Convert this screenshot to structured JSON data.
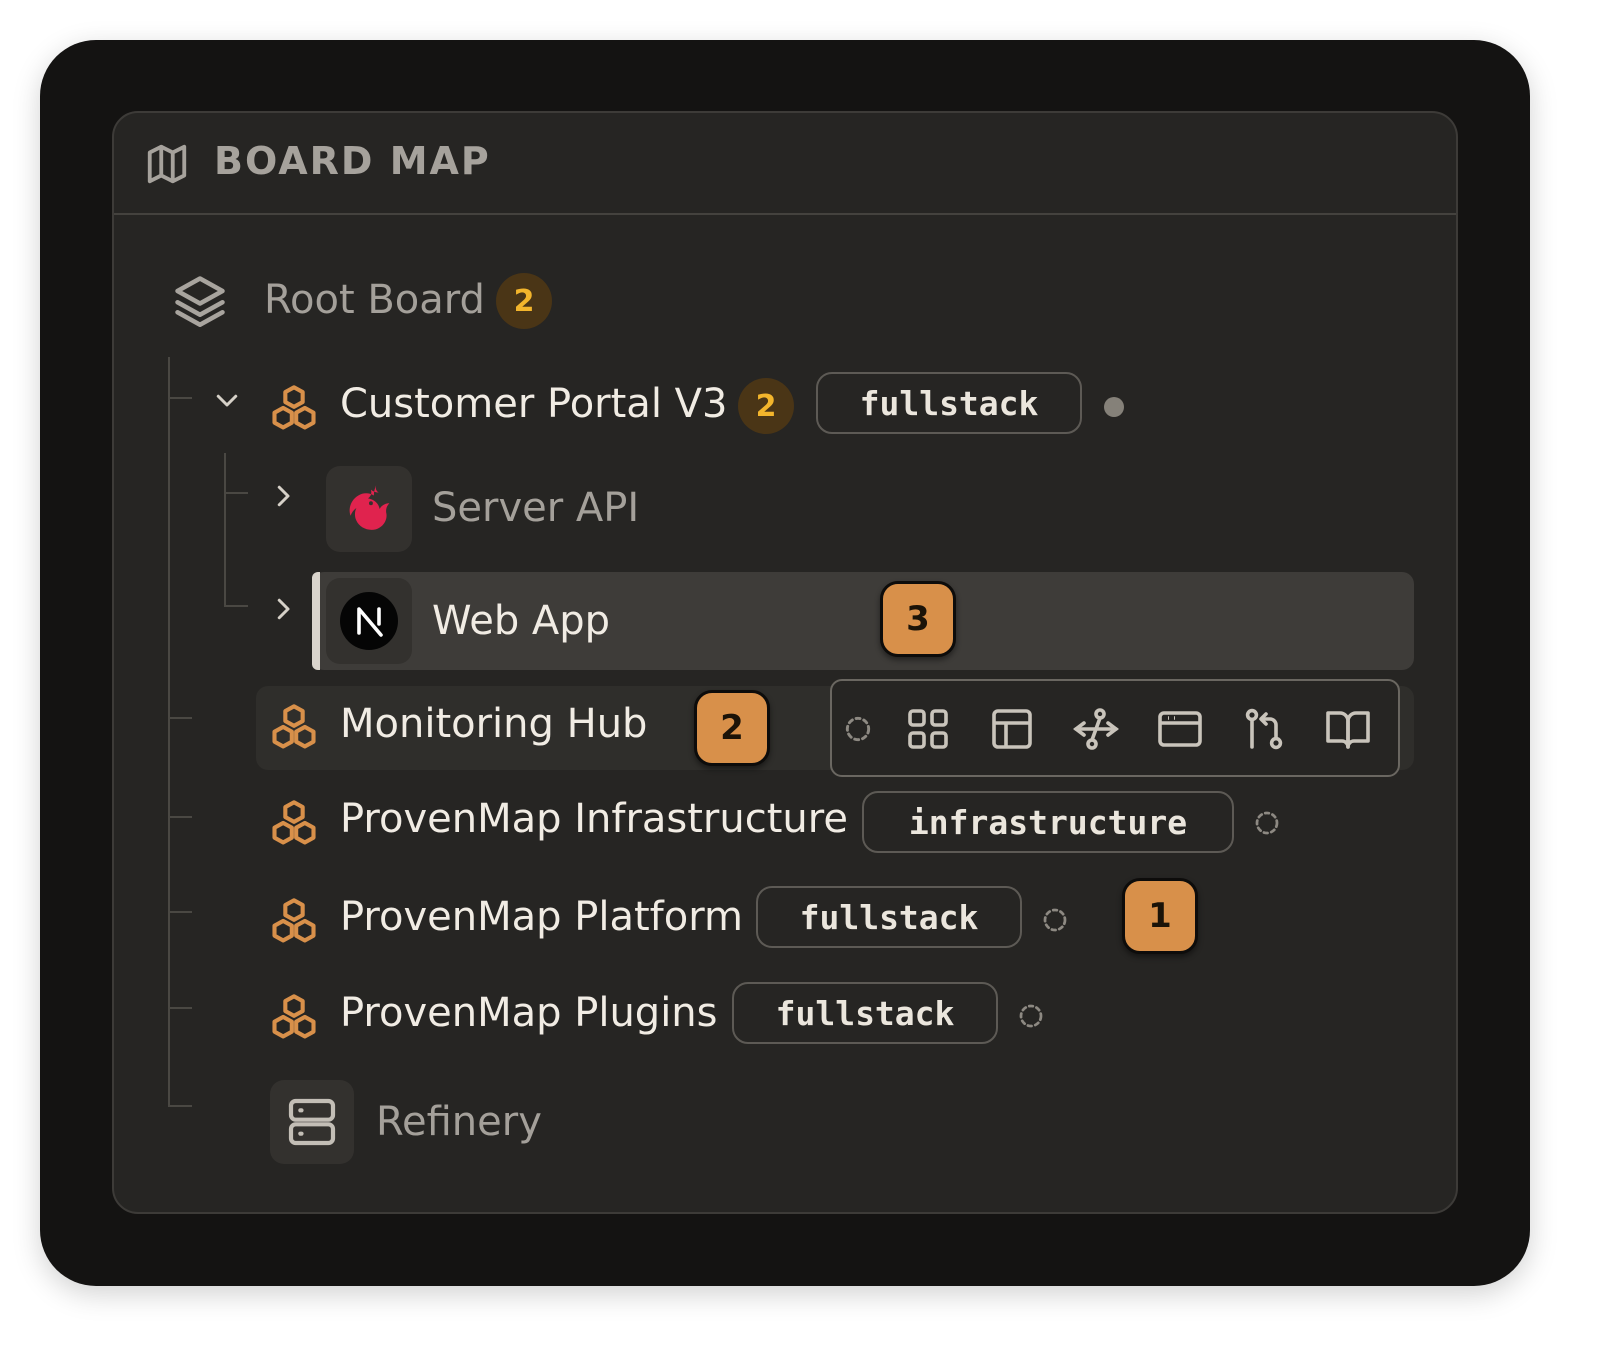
{
  "panel": {
    "title": "BOARD MAP"
  },
  "root": {
    "label": "Root Board",
    "count": "2"
  },
  "items": {
    "customer_portal": {
      "label": "Customer Portal V3",
      "count": "2",
      "tag": "fullstack"
    },
    "server_api": {
      "label": "Server API"
    },
    "web_app": {
      "label": "Web App",
      "badge": "3"
    },
    "monitoring_hub": {
      "label": "Monitoring Hub",
      "badge": "2"
    },
    "infrastructure": {
      "label": "ProvenMap Infrastructure",
      "tag": "infrastructure"
    },
    "platform": {
      "label": "ProvenMap Platform",
      "tag": "fullstack",
      "badge": "1"
    },
    "plugins": {
      "label": "ProvenMap Plugins",
      "tag": "fullstack"
    },
    "refinery": {
      "label": "Refinery"
    }
  },
  "action_bar": {
    "buttons": [
      "loading-icon",
      "grid-icon",
      "table-icon",
      "workflow-icon",
      "browser-window-icon",
      "git-pull-request-icon",
      "book-open-icon"
    ]
  },
  "colors": {
    "accent_orange": "#d8904a",
    "count_text": "#f3b52c",
    "nest_red": "#e0234e",
    "panel_bg": "#262523"
  }
}
